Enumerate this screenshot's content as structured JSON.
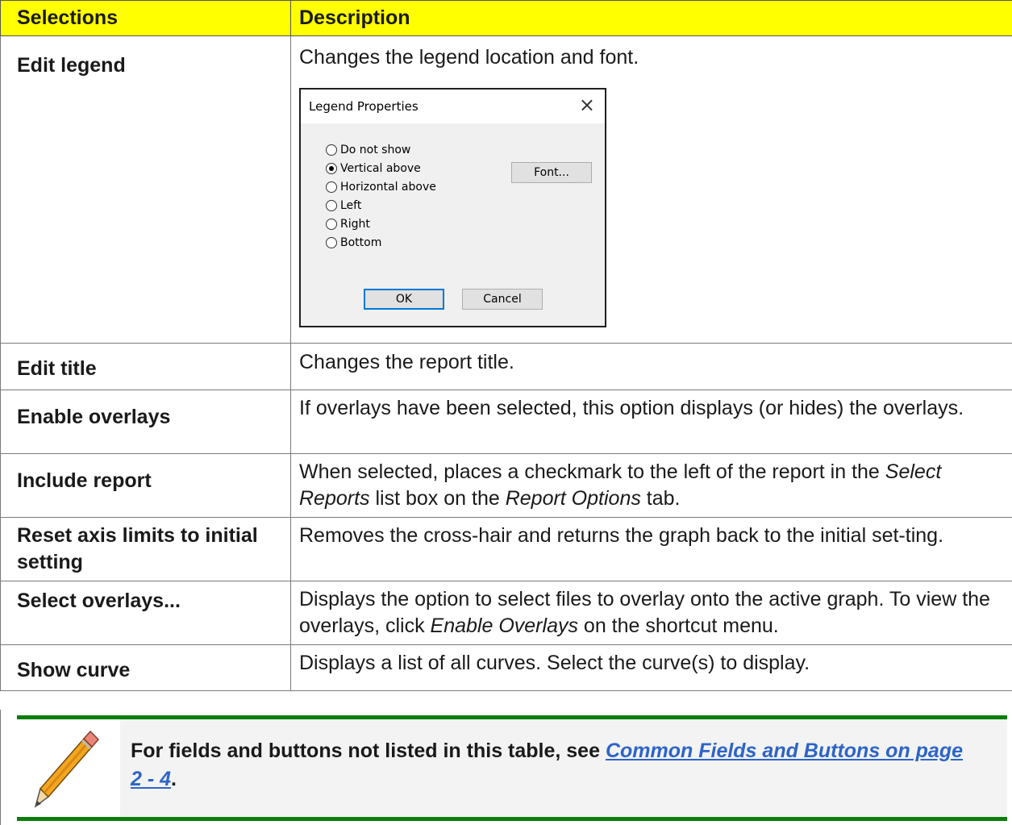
{
  "table": {
    "header": {
      "col1": "Selections",
      "col2": "Description"
    },
    "rows": [
      {
        "selection": "Edit legend",
        "description": "Changes the legend location and font."
      },
      {
        "selection": "Edit title",
        "description": "Changes the report title."
      },
      {
        "selection": "Enable overlays",
        "description": "If overlays have been selected, this option displays (or hides) the overlays."
      },
      {
        "selection": "Include report",
        "desc_pre": "When selected, places a checkmark to the left of the report in the",
        "desc_em1": "Select Reports",
        "desc_mid": " list box on the ",
        "desc_em2": "Report Options",
        "desc_post": " tab."
      },
      {
        "selection": "Reset axis limits to initial setting",
        "description": "Removes the cross-hair and returns the graph back to the initial set-ting."
      },
      {
        "selection": "Select overlays...",
        "desc_pre": "Displays the option to select files to overlay onto the active graph. To view the overlays, click ",
        "desc_em": "Enable Overlays",
        "desc_post": " on the shortcut menu."
      },
      {
        "selection": "Show curve",
        "description": "Displays a list of all curves. Select the curve(s) to display."
      }
    ]
  },
  "dialog": {
    "title": "Legend Properties",
    "close_icon": "×",
    "options": [
      "Do not show",
      "Vertical above",
      "Horizontal above",
      "Left",
      "Right",
      "Bottom"
    ],
    "selected": "Vertical above",
    "font_button": "Font...",
    "ok_button": "OK",
    "cancel_button": "Cancel"
  },
  "note": {
    "icon": "pencil-icon",
    "text_pre": "For fields and buttons not listed in this table, see ",
    "link": "Common Fields and Buttons on page 2 - 4",
    "text_post": ".",
    "accent_color": "#0a7d0a"
  }
}
